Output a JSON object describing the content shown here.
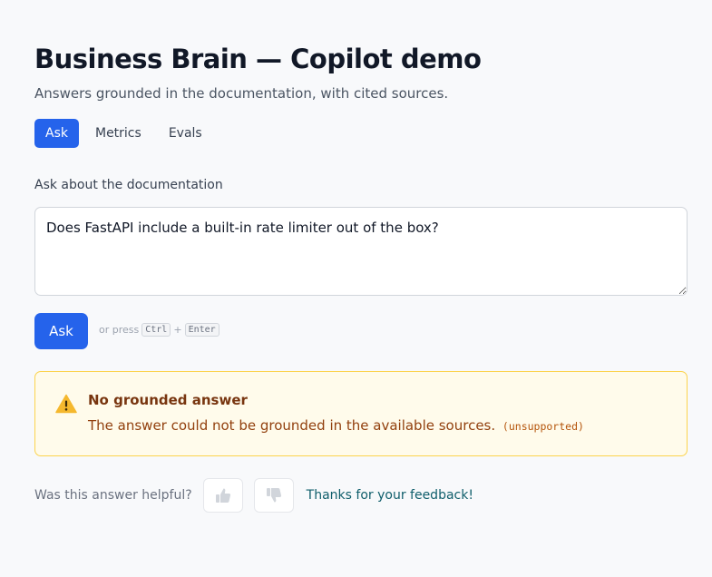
{
  "header": {
    "title": "Business Brain — Copilot demo",
    "subtitle": "Answers grounded in the documentation, with cited sources."
  },
  "tabs": [
    {
      "label": "Ask",
      "active": true
    },
    {
      "label": "Metrics",
      "active": false
    },
    {
      "label": "Evals",
      "active": false
    }
  ],
  "question": {
    "label": "Ask about the documentation",
    "value": "Does FastAPI include a built-in rate limiter out of the box?"
  },
  "ask_button": {
    "label": "Ask",
    "hint_prefix": "or press",
    "key1": "Ctrl",
    "plus": "+",
    "key2": "Enter"
  },
  "alert": {
    "icon": "warning-icon",
    "title": "No grounded answer",
    "body": "The answer could not be grounded in the available sources.",
    "code": "(unsupported)"
  },
  "feedback": {
    "question": "Was this answer helpful?",
    "up_icon": "thumbs-up-icon",
    "down_icon": "thumbs-down-icon",
    "thanks": "Thanks for your feedback!"
  },
  "colors": {
    "accent": "#2563eb",
    "warning_bg": "#fffbeb",
    "warning_border": "#fcd34d",
    "warning_icon": "#f5b82e"
  }
}
